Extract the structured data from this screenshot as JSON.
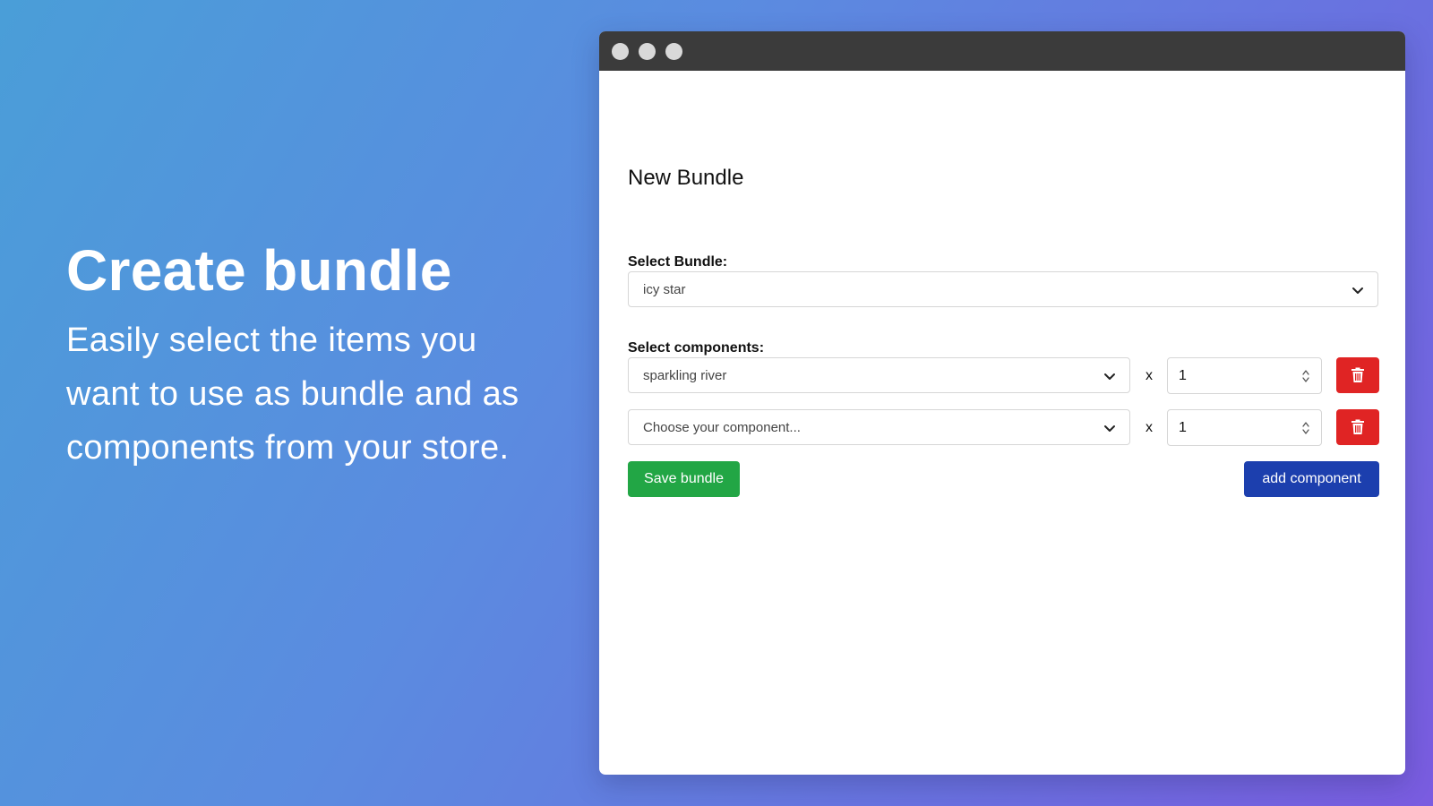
{
  "hero": {
    "title": "Create bundle",
    "description": "Easily select the items you want to use as bundle and as components from your store."
  },
  "form": {
    "title": "New Bundle",
    "bundle_label": "Select Bundle:",
    "bundle_value": "icy star",
    "components_label": "Select components:",
    "components": [
      {
        "value": "sparkling river",
        "multiplier": "x",
        "quantity": "1"
      },
      {
        "value": "Choose your component...",
        "multiplier": "x",
        "quantity": "1"
      }
    ],
    "save_label": "Save bundle",
    "add_label": "add component"
  },
  "colors": {
    "save": "#22a645",
    "add": "#1c3fae",
    "delete": "#e02424",
    "titlebar": "#3b3b3b"
  },
  "icons": {
    "dropdown": "chevron-down-icon",
    "delete": "trash-icon",
    "stepper": "stepper-arrows-icon"
  }
}
